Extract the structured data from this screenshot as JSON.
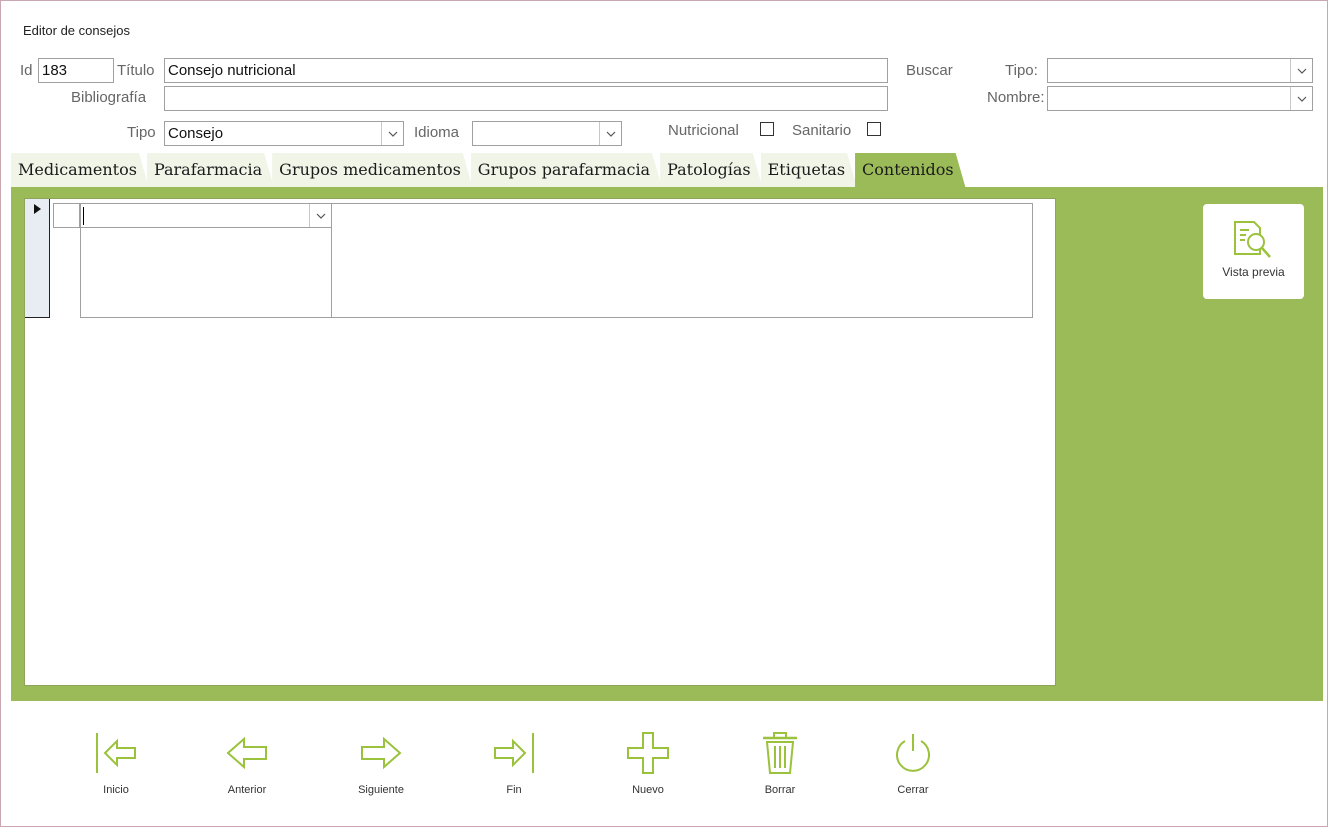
{
  "window": {
    "title": "Editor de consejos"
  },
  "form": {
    "id_label": "Id",
    "id_value": "183",
    "titulo_label": "Título",
    "titulo_value": "Consejo nutricional",
    "bibliografia_label": "Bibliografía",
    "bibliografia_value": "",
    "tipo_label": "Tipo",
    "tipo_value": "Consejo",
    "idioma_label": "Idioma",
    "idioma_value": "",
    "nutricional_label": "Nutricional",
    "nutricional_checked": false,
    "sanitario_label": "Sanitario",
    "sanitario_checked": false
  },
  "search": {
    "buscar_label": "Buscar",
    "tipo_label": "Tipo:",
    "tipo_value": "",
    "nombre_label": "Nombre:",
    "nombre_value": ""
  },
  "tabs": [
    {
      "label": "Medicamentos",
      "active": false
    },
    {
      "label": "Parafarmacia",
      "active": false
    },
    {
      "label": "Grupos medicamentos",
      "active": false
    },
    {
      "label": "Grupos parafarmacia",
      "active": false
    },
    {
      "label": "Patologías",
      "active": false
    },
    {
      "label": "Etiquetas",
      "active": false
    },
    {
      "label": "Contenidos",
      "active": true
    }
  ],
  "content": {
    "row_combo_value": "",
    "preview_button_label": "Vista previa"
  },
  "toolbar": [
    {
      "label": "Inicio",
      "icon": "first-record-icon"
    },
    {
      "label": "Anterior",
      "icon": "previous-arrow-icon"
    },
    {
      "label": "Siguiente",
      "icon": "next-arrow-icon"
    },
    {
      "label": "Fin",
      "icon": "last-record-icon"
    },
    {
      "label": "Nuevo",
      "icon": "plus-icon"
    },
    {
      "label": "Borrar",
      "icon": "trash-icon"
    },
    {
      "label": "Cerrar",
      "icon": "power-icon"
    }
  ],
  "colors": {
    "accent": "#9bbb59",
    "tab_inactive": "#f1f5e8",
    "icon": "#9bc23c"
  }
}
